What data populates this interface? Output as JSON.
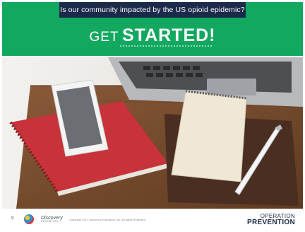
{
  "slide": {
    "question": "Is our community impacted by the US opioid epidemic?",
    "headline_small": "GET",
    "headline_large": "STARTED!",
    "page_number": "9",
    "footer": {
      "discovery_logo": "Discovery",
      "discovery_logo_sub": "EDUCATION",
      "copyright": "Copyright 2017 Discovery Education, Inc. All rights Reserved.",
      "operation_prevention_line1": "OPERATION",
      "operation_prevention_line2": "PREVENTION"
    }
  },
  "colors": {
    "band_green": "#12a860",
    "question_tab_navy": "#1b2a4a",
    "logo_red": "#d8272f"
  }
}
